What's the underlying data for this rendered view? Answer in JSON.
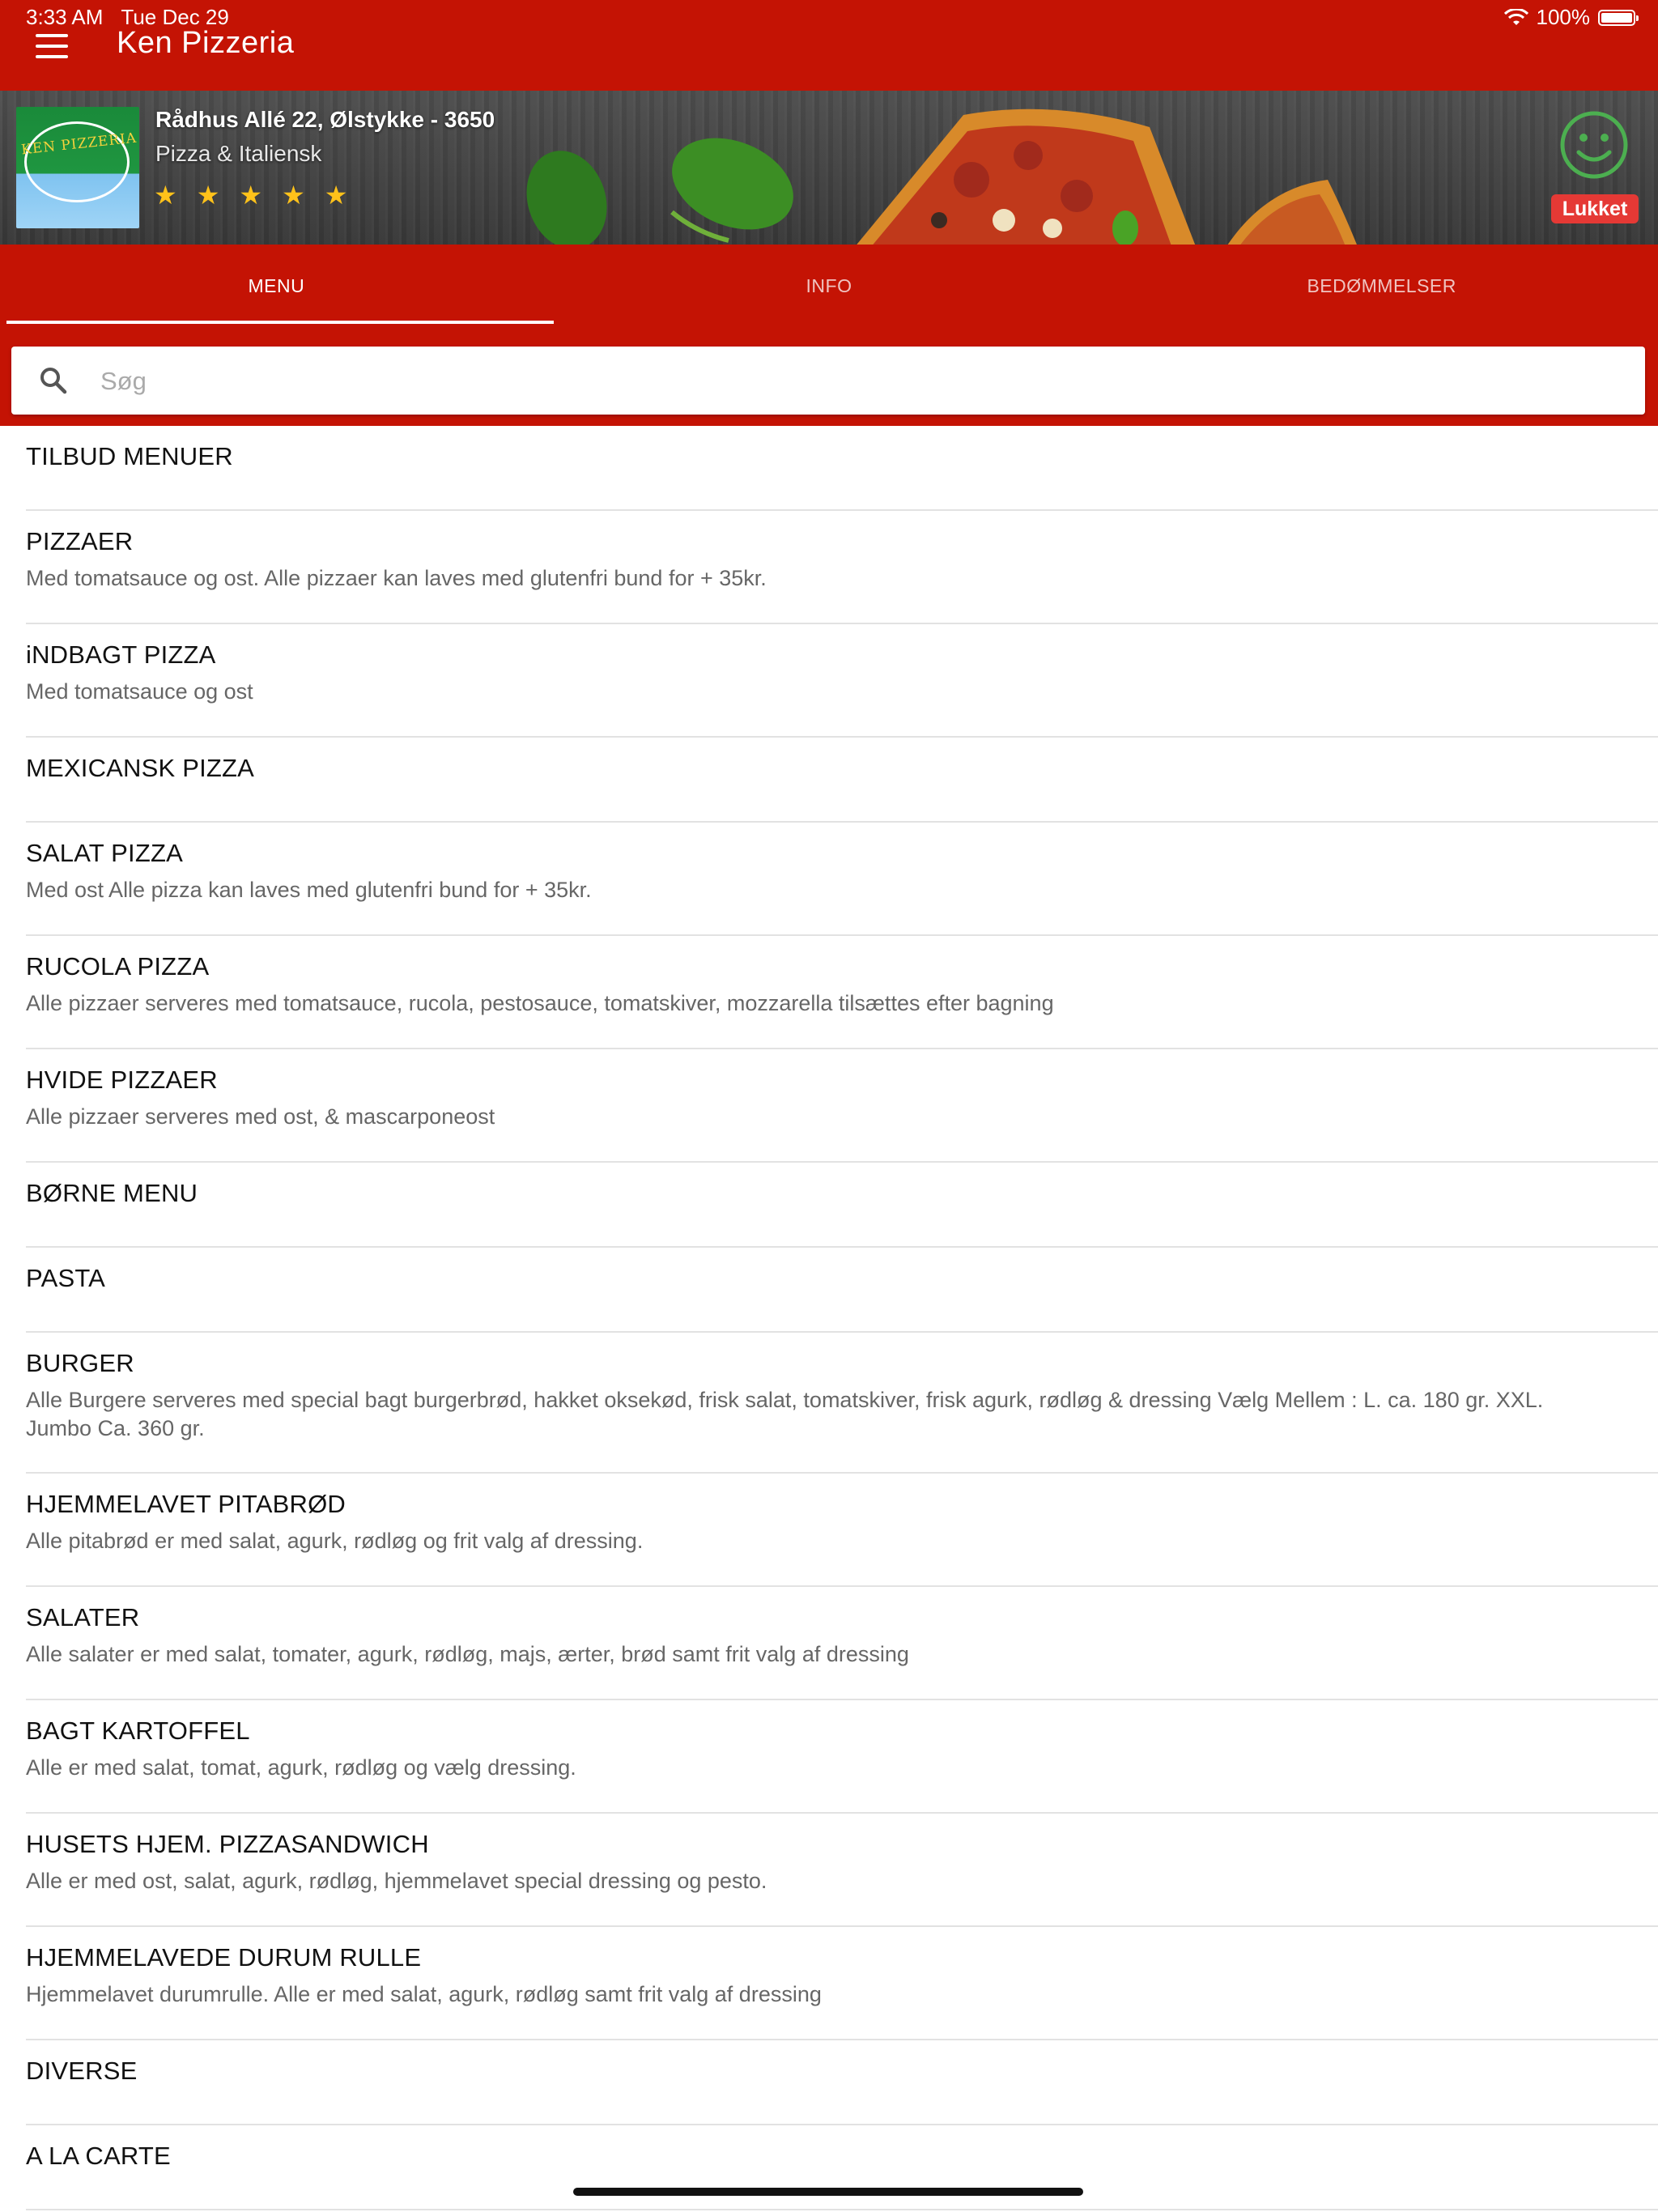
{
  "status_bar": {
    "time": "3:33 AM",
    "date": "Tue Dec 29",
    "battery": "100%"
  },
  "header": {
    "title": "Ken Pizzeria"
  },
  "restaurant": {
    "address": "Rådhus Allé 22, Ølstykke - 3650",
    "cuisine": "Pizza & Italiensk",
    "logo_text": "KEN PIZZERIA",
    "rating_stars": 5,
    "star_glyph": "★",
    "status": "Lukket",
    "status_icon": "smiley-icon"
  },
  "tabs": [
    {
      "label": "MENU",
      "active": true
    },
    {
      "label": "INFO",
      "active": false
    },
    {
      "label": "BEDØMMELSER",
      "active": false
    }
  ],
  "search": {
    "placeholder": "Søg",
    "value": ""
  },
  "categories": [
    {
      "title": "TILBUD MENUER",
      "desc": ""
    },
    {
      "title": "PIZZAER",
      "desc": "Med tomatsauce og ost. Alle pizzaer kan laves med glutenfri bund for + 35kr."
    },
    {
      "title": "iNDBAGT PIZZA",
      "desc": "Med tomatsauce og ost"
    },
    {
      "title": "MEXICANSK PIZZA",
      "desc": ""
    },
    {
      "title": "SALAT PIZZA",
      "desc": "Med ost Alle pizza kan laves med glutenfri bund for + 35kr."
    },
    {
      "title": "RUCOLA PIZZA",
      "desc": "Alle pizzaer serveres med tomatsauce, rucola, pestosauce, tomatskiver, mozzarella tilsættes efter bagning"
    },
    {
      "title": "HVIDE PIZZAER",
      "desc": "Alle pizzaer serveres med ost, & mascarponeost"
    },
    {
      "title": "BØRNE MENU",
      "desc": ""
    },
    {
      "title": "PASTA",
      "desc": ""
    },
    {
      "title": "BURGER",
      "desc": "Alle Burgere serveres med special bagt burgerbrød, hakket oksekød, frisk salat, tomatskiver, frisk agurk, rødløg & dressing Vælg Mellem : L. ca. 180 gr. XXL. Jumbo Ca. 360 gr."
    },
    {
      "title": "HJEMMELAVET PITABRØD",
      "desc": "Alle pitabrød er med salat, agurk, rødløg og frit valg af dressing."
    },
    {
      "title": "SALATER",
      "desc": "Alle salater er med salat, tomater, agurk, rødløg, majs, ærter, brød samt frit valg af dressing"
    },
    {
      "title": "BAGT KARTOFFEL",
      "desc": "Alle er med salat, tomat, agurk, rødløg og vælg dressing."
    },
    {
      "title": "HUSETS HJEM. PIZZASANDWICH",
      "desc": "Alle er med ost, salat, agurk, rødløg, hjemmelavet special dressing og pesto."
    },
    {
      "title": "HJEMMELAVEDE DURUM RULLE",
      "desc": "Hjemmelavet durumrulle. Alle er med salat, agurk, rødløg samt frit valg af dressing"
    },
    {
      "title": "DIVERSE",
      "desc": ""
    },
    {
      "title": "A LA CARTE",
      "desc": ""
    }
  ],
  "colors": {
    "brand_red": "#c41304",
    "closed_badge": "#e53935",
    "star": "#ffc21a",
    "smiley": "#4caf50"
  }
}
